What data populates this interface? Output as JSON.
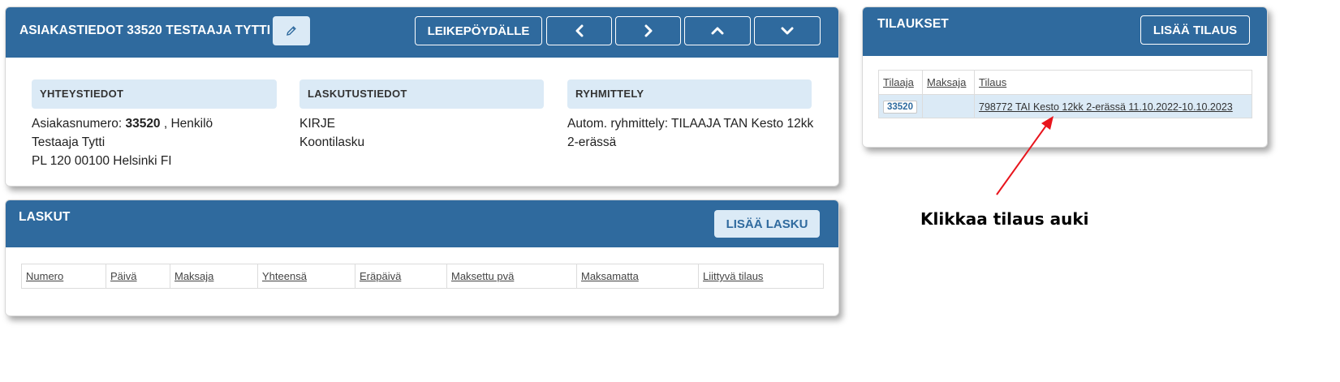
{
  "customer": {
    "title": "ASIAKASTIEDOT 33520 TESTAAJA TYTTI",
    "clipboard_label": "LEIKEPÖYDÄLLE",
    "contact": {
      "header": "YHTEYSTIEDOT",
      "number_prefix": "Asiakasnumero: ",
      "number": "33520",
      "number_suffix": " , Henkilö",
      "name": "Testaaja Tytti",
      "address": "PL 120 00100 Helsinki FI"
    },
    "billing": {
      "header": "LASKUTUSTIEDOT",
      "line1": "KIRJE",
      "line2": "Koontilasku"
    },
    "grouping": {
      "header": "RYHMITTELY",
      "line1": "Autom. ryhmittely: TILAAJA TAN Kesto 12kk",
      "line2": "2-erässä"
    }
  },
  "invoices": {
    "title": "LASKUT",
    "add_label": "LISÄÄ LASKU",
    "columns": [
      "Numero",
      "Päivä",
      "Maksaja",
      "Yhteensä",
      "Eräpäivä",
      "Maksettu pvä",
      "Maksamatta",
      "Liittyvä tilaus"
    ]
  },
  "orders": {
    "title": "TILAUKSET",
    "add_label": "LISÄÄ TILAUS",
    "columns": [
      "Tilaaja",
      "Maksaja",
      "Tilaus"
    ],
    "row": {
      "orderer": "33520",
      "payer": "",
      "order": "798772 TAI Kesto 12kk 2-erässä 11.10.2022-10.10.2023"
    }
  },
  "annotation": {
    "text": "Klikkaa tilaus auki",
    "arrow_color": "#e8141c"
  },
  "colors": {
    "header_bg": "#2f6a9e",
    "light_bg": "#dbeaf6"
  }
}
